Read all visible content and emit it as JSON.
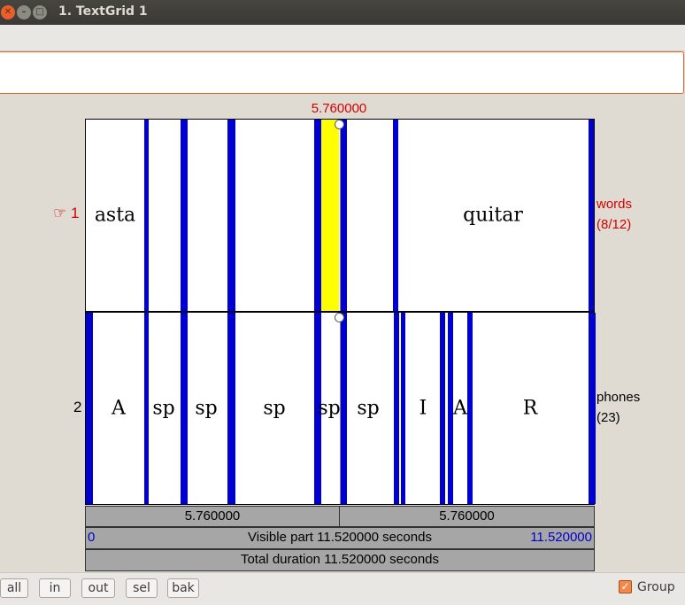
{
  "window": {
    "title": "1. TextGrid 1"
  },
  "cursor": {
    "time": "5.760000"
  },
  "tiers": [
    {
      "number": "☞ 1",
      "name": "words",
      "info": "(8/12)",
      "color": "#d40000",
      "labels": [
        "asta",
        "quitar"
      ]
    },
    {
      "number": "2",
      "name": "phones",
      "info": "(23)",
      "color": "#000000",
      "labels": [
        "A",
        "sp",
        "sp",
        "sp",
        "sp",
        "sp",
        "I",
        "A",
        "R"
      ]
    }
  ],
  "bars": {
    "left_time": "5.760000",
    "right_time": "5.760000",
    "visible_start": "0",
    "visible_text": "Visible part 11.520000 seconds",
    "visible_end": "11.520000",
    "total_text": "Total duration 11.520000 seconds"
  },
  "buttons": {
    "all": "all",
    "in": "in",
    "out": "out",
    "sel": "sel",
    "bak": "bak"
  },
  "group": {
    "label": "Group",
    "checked": true
  }
}
